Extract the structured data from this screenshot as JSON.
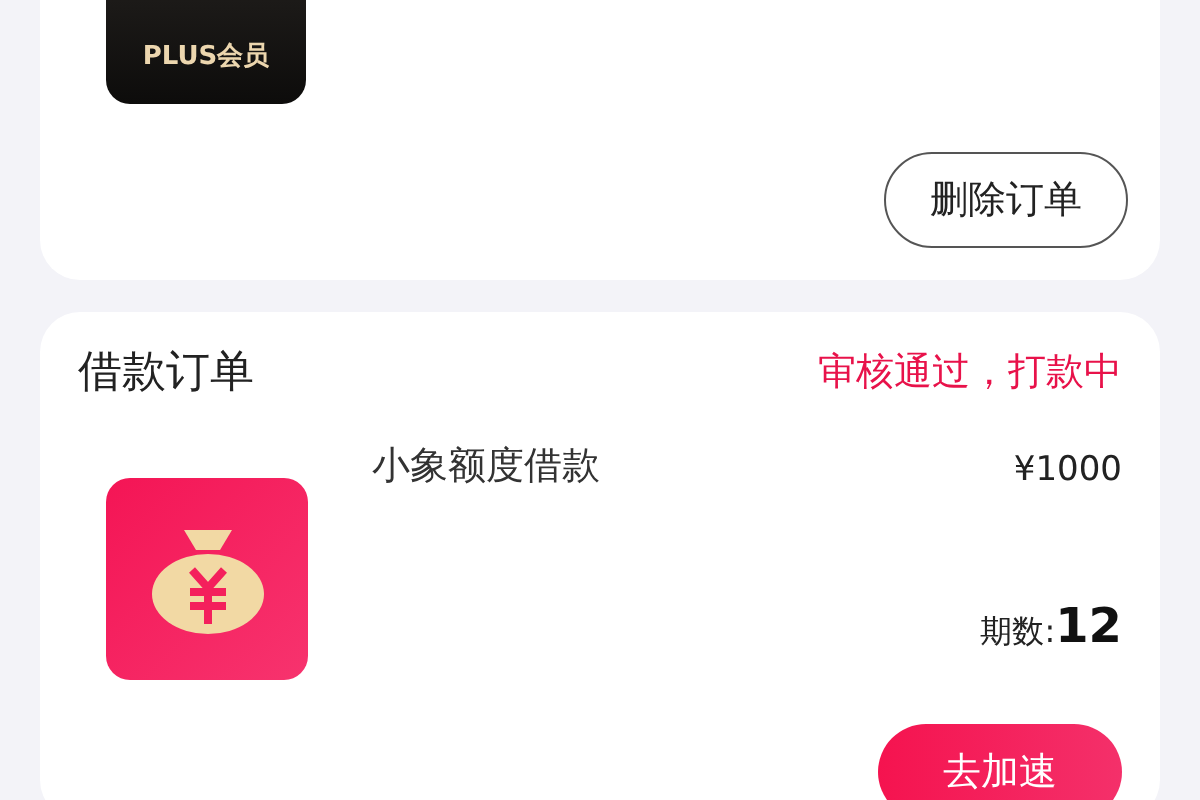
{
  "membership_order": {
    "product_badge": "PLUS会员",
    "button": "删除订单"
  },
  "loan_order": {
    "title": "借款订单",
    "status": "审核通过，打款中",
    "product_name": "小象额度借款",
    "amount": "¥1000",
    "term_label": "期数:",
    "term_value": "12",
    "button": "去加速"
  }
}
